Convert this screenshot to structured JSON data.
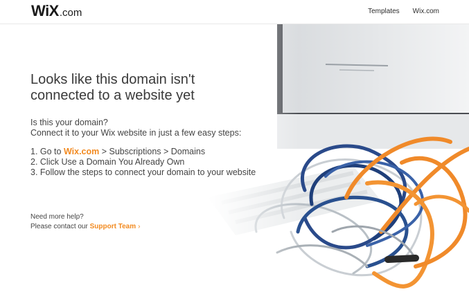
{
  "header": {
    "logo_main": "WiX",
    "logo_suffix": ".com",
    "nav": [
      {
        "label": "Templates"
      },
      {
        "label": "Wix.com"
      }
    ]
  },
  "main": {
    "title": "Looks like this domain isn't connected to a website yet",
    "intro_line1": "Is this your domain?",
    "intro_line2": "Connect it to your Wix website in just a few easy steps:",
    "step1_prefix": "1. Go to ",
    "step1_link": "Wix.com",
    "step1_suffix": " > Subscriptions > Domains",
    "step2": "2. Click Use a Domain You Already Own",
    "step3": "3. Follow the steps to connect your domain to your website",
    "help_line1": "Need more help?",
    "help_line2_prefix": "Please contact our ",
    "help_link": "Support Team",
    "help_chevron": "›"
  },
  "colors": {
    "accent": "#f28a20",
    "text": "#3a3a3a"
  }
}
